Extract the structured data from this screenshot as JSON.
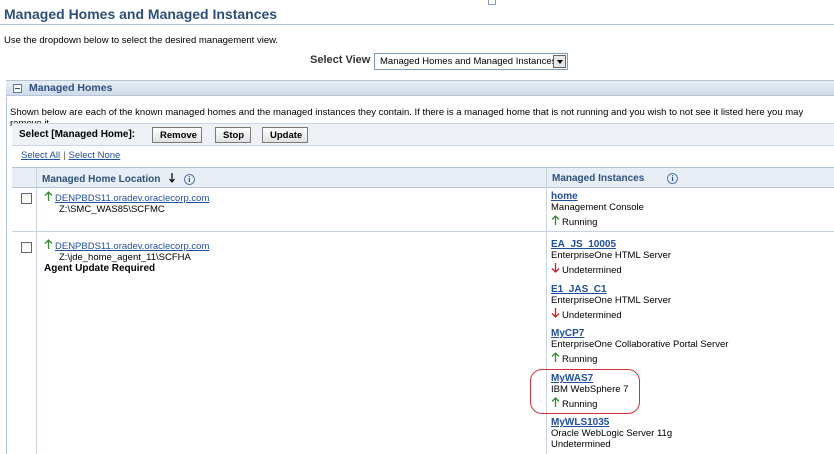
{
  "page": {
    "title": "Managed Homes and Managed Instances",
    "intro": "Use the dropdown below to select the desired management view."
  },
  "view_selector": {
    "label": "Select View",
    "selected": "Managed Homes and Managed Instances"
  },
  "section": {
    "title": "Managed Homes",
    "description": "Shown below are each of the known managed homes and the managed instances they contain. If there is a managed home that is not running and you wish to not see it listed here you may remove it."
  },
  "toolbar": {
    "label": "Select [Managed Home]:",
    "remove_label": "Remove",
    "stop_label": "Stop",
    "update_label": "Update"
  },
  "selection_links": {
    "select_all": "Select All",
    "separator": "|",
    "select_none": "Select None"
  },
  "table": {
    "headers": {
      "location": "Managed Home Location",
      "instances": "Managed Instances"
    },
    "rows": [
      {
        "host": "DENPBDS11.oradev.oraclecorp.com",
        "path": "Z:\\SMC_WAS85\\SCFMC",
        "note": "",
        "instances": [
          {
            "name": "home",
            "type": "Management Console",
            "status": "Running",
            "status_icon": "up-arrow"
          }
        ]
      },
      {
        "host": "DENPBDS11.oradev.oraclecorp.com",
        "path": "Z:\\jde_home_agent_11\\SCFHA",
        "note": "Agent Update Required",
        "instances": [
          {
            "name": "EA_JS_10005",
            "type": "EnterpriseOne HTML Server",
            "status": "Undetermined",
            "status_icon": "down-arrow"
          },
          {
            "name": "E1_JAS_C1",
            "type": "EnterpriseOne HTML Server",
            "status": "Undetermined",
            "status_icon": "down-arrow"
          },
          {
            "name": "MyCP7",
            "type": "EnterpriseOne Collaborative Portal Server",
            "status": "Running",
            "status_icon": "up-arrow"
          },
          {
            "name": "MyWAS7",
            "type": "IBM WebSphere 7",
            "status": "Running",
            "status_icon": "up-arrow"
          },
          {
            "name": "MyWLS1035",
            "type": "Oracle WebLogic Server 11g",
            "status": "Undetermined",
            "status_icon": ""
          }
        ]
      }
    ]
  },
  "colors": {
    "title": "#2d4f7c",
    "link": "#1f4f9f",
    "status_up": "#2f8f2f",
    "status_down": "#c8201e",
    "highlight_ring": "#d2333a"
  }
}
